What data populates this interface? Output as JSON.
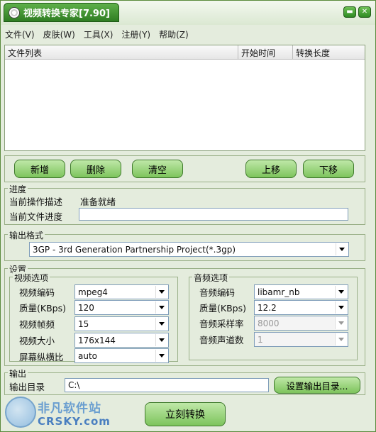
{
  "window": {
    "title": "视频转换专家[7.90]"
  },
  "menu": [
    "文件(V)",
    "皮肤(W)",
    "工具(X)",
    "注册(Y)",
    "帮助(Z)"
  ],
  "filelist": {
    "columns": [
      "文件列表",
      "开始时间",
      "转换长度"
    ]
  },
  "buttons": {
    "add": "新增",
    "delete": "删除",
    "clear": "清空",
    "up": "上移",
    "down": "下移"
  },
  "progress": {
    "title": "进度",
    "op_label": "当前操作描述",
    "op_value": "准备就绪",
    "file_label": "当前文件进度"
  },
  "output_format": {
    "title": "输出格式",
    "value": "3GP - 3rd Generation Partnership Project(*.3gp)"
  },
  "settings": {
    "title": "设置",
    "video": {
      "title": "视频选项",
      "codec_label": "视频编码",
      "codec": "mpeg4",
      "quality_label": "质量(KBps)",
      "quality": "120",
      "fps_label": "视频帧频",
      "fps": "15",
      "size_label": "视频大小",
      "size": "176x144",
      "aspect_label": "屏幕纵横比",
      "aspect": "auto"
    },
    "audio": {
      "title": "音频选项",
      "codec_label": "音频编码",
      "codec": "libamr_nb",
      "quality_label": "质量(KBps)",
      "quality": "12.2",
      "samplerate_label": "音频采样率",
      "samplerate": "8000",
      "channels_label": "音频声道数",
      "channels": "1"
    }
  },
  "output": {
    "title": "输出",
    "dir_label": "输出目录",
    "dir_value": "C:\\",
    "set_dir_button": "设置输出目录..."
  },
  "convert_button": "立刻转换",
  "watermark": {
    "line1": "非凡软件站",
    "line2": "CRSKY.com"
  }
}
